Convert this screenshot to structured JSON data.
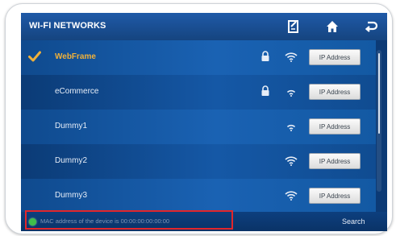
{
  "title": "WI-FI NETWORKS",
  "toolbar": {
    "icons": [
      "edit-icon",
      "home-icon",
      "back-icon"
    ]
  },
  "networks": [
    {
      "ssid": "WebFrame",
      "connected": true,
      "locked": true,
      "ip_label": "IP Address"
    },
    {
      "ssid": "eCommerce",
      "connected": false,
      "locked": true,
      "ip_label": "IP Address"
    },
    {
      "ssid": "Dummy1",
      "connected": false,
      "locked": false,
      "ip_label": "IP Address"
    },
    {
      "ssid": "Dummy2",
      "connected": false,
      "locked": false,
      "ip_label": "IP Address"
    },
    {
      "ssid": "Dummy3",
      "connected": false,
      "locked": false,
      "ip_label": "IP Address"
    }
  ],
  "status": {
    "text": "MAC address of the device is 00:00:00:00:00:00",
    "dot_color": "#3fbf4a"
  },
  "search_label": "Search",
  "colors": {
    "active_ssid": "#f0b13a",
    "highlight": "#e2262b",
    "screen_bg": "#0c3a75"
  }
}
